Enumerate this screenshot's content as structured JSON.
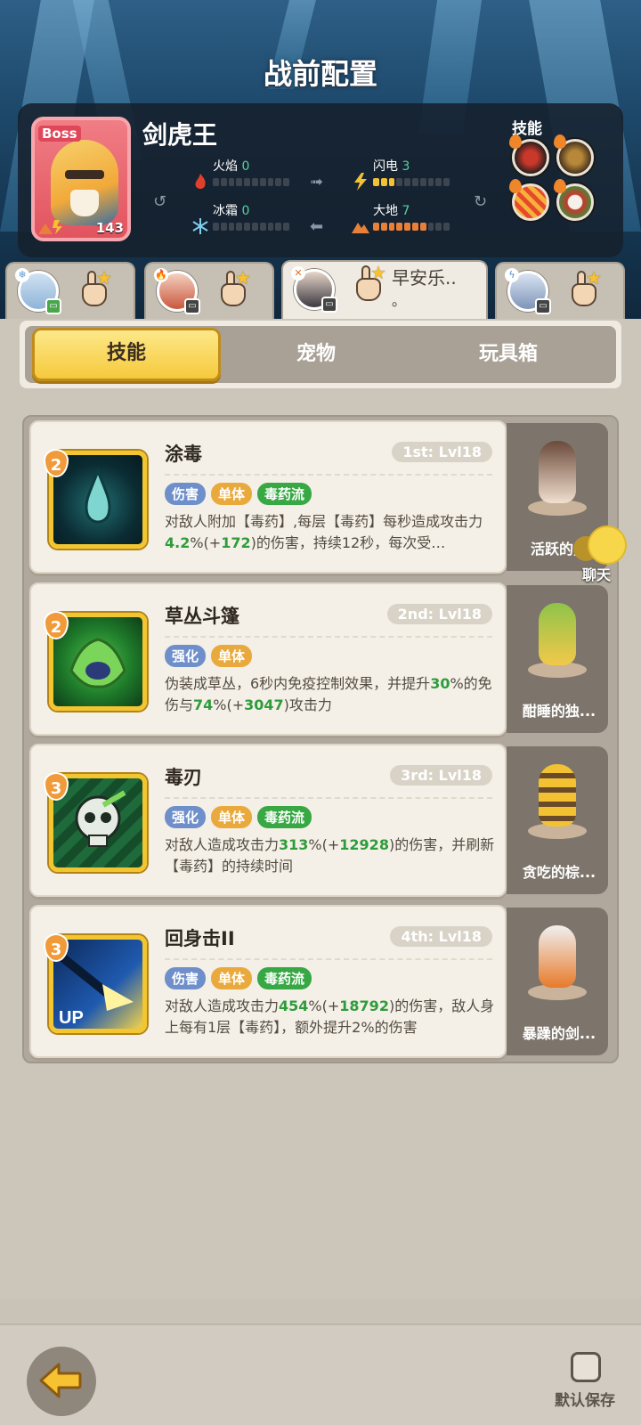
{
  "header": {
    "title": "战前配置"
  },
  "boss": {
    "tag": "Boss",
    "name": "剑虎王",
    "level": "143",
    "elements": [
      {
        "label": "火焰",
        "value": "0",
        "filled": 0
      },
      {
        "label": "闪电",
        "value": "3",
        "filled": 3
      },
      {
        "label": "冰霜",
        "value": "0",
        "filled": 0
      },
      {
        "label": "大地",
        "value": "7",
        "filled": 7
      }
    ],
    "skills_label": "技能",
    "skill_icons": [
      "fanged-mouth-icon",
      "horned-beast-icon",
      "claw-slash-icon",
      "red-white-orb-icon"
    ]
  },
  "heroes": [
    {
      "name": "",
      "name_line2": "",
      "active": false,
      "badge": "chat",
      "element": "ice"
    },
    {
      "name": "",
      "name_line2": "",
      "active": false,
      "badge": "chat",
      "element": "fire"
    },
    {
      "name": "早安乐..",
      "name_line2": "。",
      "active": true,
      "badge": "chat",
      "element": "fire"
    },
    {
      "name": "",
      "name_line2": "",
      "active": false,
      "badge": "chat",
      "element": "lightning"
    }
  ],
  "tabs": {
    "skills": "技能",
    "pets": "宠物",
    "toybox": "玩具箱"
  },
  "skills": [
    {
      "level": "2",
      "name": "涂毒",
      "rank": "1st: Lvl18",
      "tags": [
        {
          "text": "伤害",
          "color": "blue"
        },
        {
          "text": "单体",
          "color": "orange"
        },
        {
          "text": "毒药流",
          "color": "green"
        }
      ],
      "desc_html": "对敌人附加【毒药】,每层【毒药】每秒造成攻击力<span class='hl'>4.2</span>%(+<span class='hl'>172</span>)的伤害，持续12秒，每次受…",
      "pet_name": "活跃的黑"
    },
    {
      "level": "2",
      "name": "草丛斗篷",
      "rank": "2nd: Lvl18",
      "tags": [
        {
          "text": "强化",
          "color": "blue"
        },
        {
          "text": "单体",
          "color": "orange"
        }
      ],
      "desc_html": "伪装成草丛，6秒内免疫控制效果，并提升<span class='hl'>30</span>%的免伤与<span class='hl'>74</span>%(+<span class='hl'>3047</span>)攻击力",
      "pet_name": "酣睡的独..."
    },
    {
      "level": "3",
      "name": "毒刃",
      "rank": "3rd: Lvl18",
      "tags": [
        {
          "text": "强化",
          "color": "blue"
        },
        {
          "text": "单体",
          "color": "orange"
        },
        {
          "text": "毒药流",
          "color": "green"
        }
      ],
      "desc_html": "对敌人造成攻击力<span class='hl'>313</span>%(+<span class='hl'>12928</span>)的伤害，并刷新【毒药】的持续时间",
      "pet_name": "贪吃的棕..."
    },
    {
      "level": "3",
      "name": "回身击II",
      "rank": "4th: Lvl18",
      "tags": [
        {
          "text": "伤害",
          "color": "blue"
        },
        {
          "text": "单体",
          "color": "orange"
        },
        {
          "text": "毒药流",
          "color": "green"
        }
      ],
      "desc_html": "对敌人造成攻击力<span class='hl'>454</span>%(+<span class='hl'>18792</span>)的伤害，敌人身上每有1层【毒药】，额外提升2%的伤害",
      "pet_name": "暴躁的剑..."
    }
  ],
  "chat": {
    "label": "聊天"
  },
  "footer": {
    "save_label": "默认保存"
  },
  "colors": {
    "accent": "#f6c93c",
    "highlight": "#2f9c3b",
    "tag_blue": "#6e8fca",
    "tag_orange": "#e9a93c",
    "tag_green": "#37a844"
  }
}
